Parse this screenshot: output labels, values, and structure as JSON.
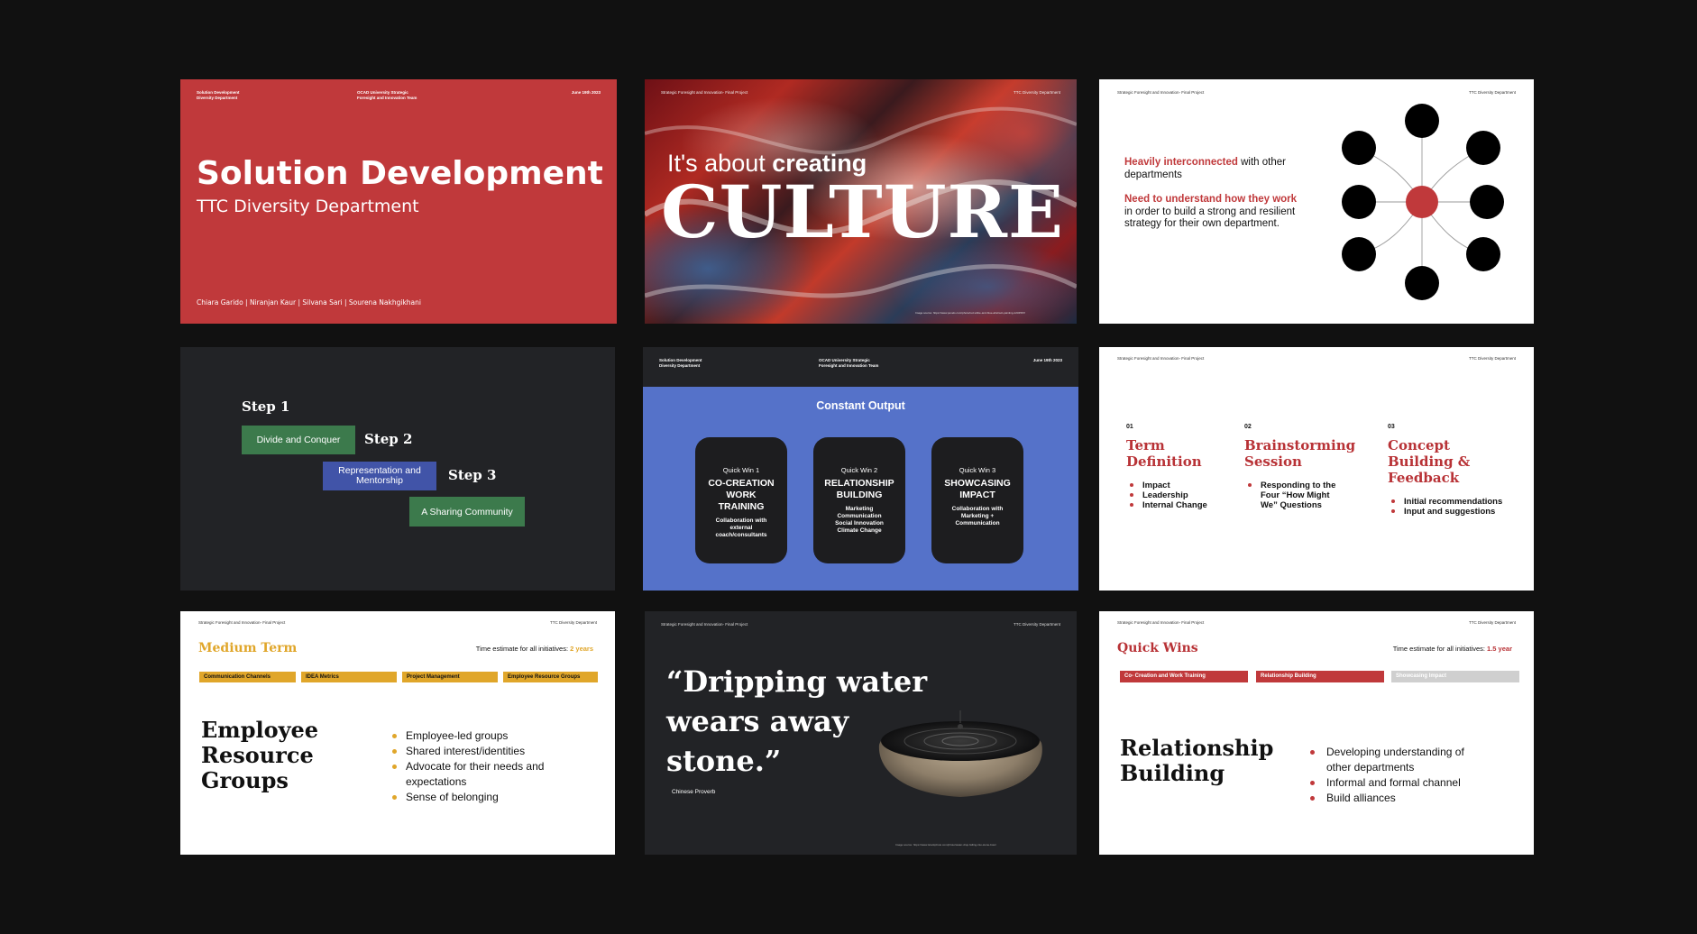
{
  "colors": {
    "bg": "#111111",
    "red": "#c0393b",
    "dark": "#222326",
    "blue": "#5572c9",
    "green": "#3c7a4c",
    "blue2": "#4154a8",
    "gold": "#e0a62a",
    "brick": "#c0393b",
    "gray": "#cfcfcf"
  },
  "s1": {
    "hl1": "Solution Development",
    "hl2": "Diversity Department",
    "hc1": "OCAD University Strategic",
    "hc2": "Foresight and Innovation Team",
    "hr": "June 19th 2023",
    "title": "Solution Development",
    "subtitle": "TTC Diversity Department",
    "authors": "Chiara Garido | Niranjan Kaur | Silvana Sari | Sourena Nakhgikhani"
  },
  "s2": {
    "hl": "Strategic Foresight and Innovation- Final Project",
    "hr": "TTC Diversity Department",
    "pre": "It's about ",
    "pre_bold": "creating",
    "big": "CULTURE",
    "credit": "Image source: https://www.pexels.com/photo/red-white-and-blue-abstract-painting-1234567/"
  },
  "s3": {
    "hl": "Strategic Foresight and Innovation- Final Project",
    "hr": "TTC Diversity Department",
    "p1_red": "Heavily interconnected",
    "p1_rest": " with other departments",
    "p2_red": "Need to understand how they work",
    "p2_rest": " in order to build a strong and resilient strategy for their own department."
  },
  "s4": {
    "step1": "Step 1",
    "step2": "Step 2",
    "step3": "Step 3",
    "box1": "Divide and Conquer",
    "box2": "Representation and Mentorship",
    "box3": "A Sharing Community"
  },
  "s5": {
    "hl1": "Solution Development",
    "hl2": "Diversity Department",
    "hc1": "OCAD University Strategic",
    "hc2": "Foresight and Innovation Team",
    "hr": "June 19th 2023",
    "title": "Constant Output",
    "cards": [
      {
        "k": "Quick Win 1",
        "t": "CO-CREATION WORK TRAINING",
        "d": "Collaboration with external coach/consultants"
      },
      {
        "k": "Quick Win 2",
        "t": "RELATIONSHIP BUILDING",
        "d": "Marketing Communication Social Innovation Climate Change"
      },
      {
        "k": "Quick Win 3",
        "t": "SHOWCASING IMPACT",
        "d": "Collaboration with Marketing + Communication"
      }
    ]
  },
  "s6": {
    "hl": "Strategic Foresight and Innovation- Final Project",
    "hr": "TTC Diversity Department",
    "cols": [
      {
        "n": "01",
        "t": "Term Definition",
        "items": [
          "Impact",
          "Leadership",
          "Internal Change"
        ]
      },
      {
        "n": "02",
        "t": "Brainstorming Session",
        "items": [
          "Responding to the Four “How Might We” Questions"
        ]
      },
      {
        "n": "03",
        "t": "Concept Building & Feedback",
        "items": [
          "Initial recommendations",
          "Input and suggestions"
        ]
      }
    ]
  },
  "s7": {
    "hl": "Strategic Foresight and Innovation- Final Project",
    "hr": "TTC Diversity Department",
    "title": "Medium Term",
    "est": "Time estimate for all initiatives: ",
    "est_val": "2 years",
    "tabs": [
      "Communication Channels",
      "IDEA Metrics",
      "Project Management",
      "Employee Resource Groups"
    ],
    "heading": "Employee Resource Groups",
    "items": [
      "Employee-led groups",
      "Shared interest/identities",
      "Advocate for their needs and expectations",
      "Sense of belonging"
    ]
  },
  "s8": {
    "hl": "Strategic Foresight and Innovation- Final Project",
    "hr": "TTC Diversity Department",
    "quote": "“Dripping water wears away stone.”",
    "source": "Chinese Proverb",
    "credit": "Image source: https://www.istockphoto.com/photo/water-drop-falling-into-stone-bowl"
  },
  "s9": {
    "hl": "Strategic Foresight and Innovation- Final Project",
    "hr": "TTC Diversity Department",
    "title": "Quick Wins",
    "est": "Time estimate for all initiatives: ",
    "est_val": "1.5 year",
    "tabs": [
      "Co- Creation and Work Training",
      "Relationship Building",
      "Showcasing Impact"
    ],
    "heading": "Relationship Building",
    "items": [
      "Developing understanding of other departments",
      "Informal and formal channel",
      "Build alliances"
    ]
  }
}
